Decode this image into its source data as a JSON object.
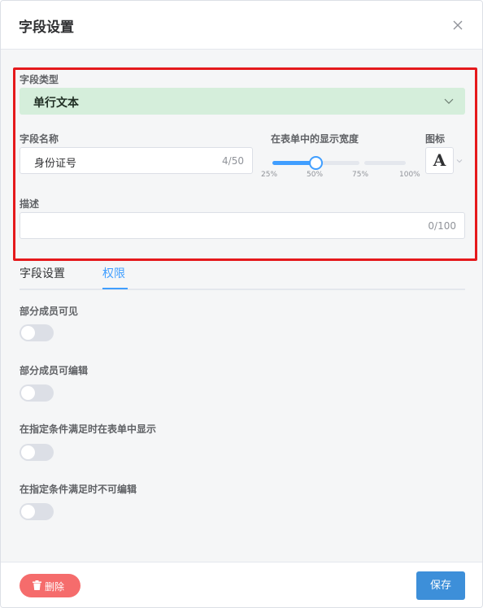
{
  "dialog": {
    "title": "字段设置"
  },
  "field": {
    "type_label": "字段类型",
    "type_value": "单行文本",
    "name_label": "字段名称",
    "name_value": "身份证号",
    "name_counter": "4/50",
    "width_label": "在表单中的显示宽度",
    "width_ticks": [
      "25%",
      "50%",
      "75%",
      "100%"
    ],
    "width_value_percent": 50,
    "icon_label": "图标",
    "icon_glyph": "A",
    "desc_label": "描述",
    "desc_value": "",
    "desc_counter": "0/100"
  },
  "tabs": [
    {
      "label": "字段设置",
      "active": false
    },
    {
      "label": "权限",
      "active": true
    }
  ],
  "permissions": [
    {
      "label": "部分成员可见",
      "enabled": false
    },
    {
      "label": "部分成员可编辑",
      "enabled": false
    },
    {
      "label": "在指定条件满足时在表单中显示",
      "enabled": false
    },
    {
      "label": "在指定条件满足时不可编辑",
      "enabled": false
    }
  ],
  "footer": {
    "delete_label": "删除",
    "save_label": "保存"
  },
  "colors": {
    "accent": "#409eff",
    "danger": "#f56c6c",
    "highlight_border": "#e5191c",
    "select_bg": "#d5eedb"
  }
}
